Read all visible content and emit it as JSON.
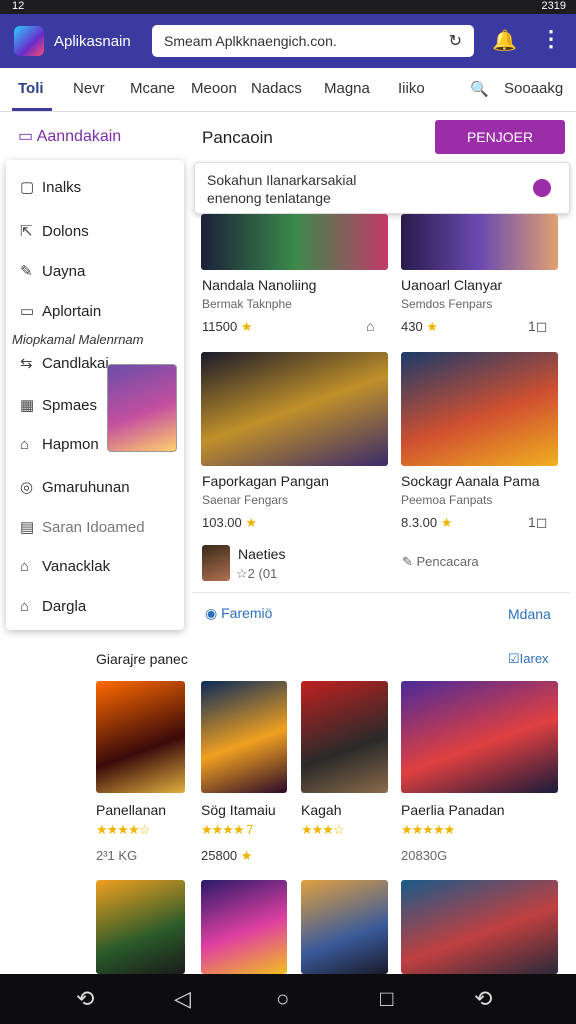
{
  "status": {
    "left": "12",
    "right": "2319"
  },
  "appbar": {
    "title": "Aplikasnain",
    "url": "Smeam Aplkknaengich.con."
  },
  "tabs": [
    "Toli",
    "Nevr",
    "Mcane",
    "Meoon",
    "Nadacs",
    "Magna",
    "Iiiko",
    "Sooaakg"
  ],
  "menu": {
    "header": "Aanndakain",
    "items": [
      "Inalks",
      "Dolons",
      "Uayna",
      "Aplortain",
      "Candlakai",
      "Spmaes",
      "Hapmon",
      "Gmaruhunan",
      "Saran Idoamed",
      "Vanacklak",
      "Dargla"
    ],
    "overlay_text": "Miopkamal Malenrnam"
  },
  "page": {
    "title": "Pancaoin",
    "primary_button": "PENJOER",
    "tooltip": "Sokahun Ilanarkarsakial\nenenong tenlatange"
  },
  "games": [
    {
      "title": "Nandala Nanoliing",
      "sub": "Bermak Taknphe",
      "price": "11500",
      "extra": "⌂"
    },
    {
      "title": "Uanoarl Clanyar",
      "sub": "Semdos Fenpars",
      "price": "430",
      "extra": "1◻"
    },
    {
      "title": "Faporkagan Pangan",
      "sub": "Saenar Fengars",
      "price": "103.00",
      "extra": ""
    },
    {
      "title": "Sockagr Aanala Pama",
      "sub": "Peemoa Fanpats",
      "price": "8.3.00",
      "extra": "1◻"
    }
  ],
  "mini": {
    "title": "Naeties",
    "rating": "☆2 (01",
    "right_label": "Pencacara"
  },
  "links": {
    "left": "Faremiö",
    "right": "Mdana"
  },
  "section2": {
    "title": "Giarajre panec",
    "link": "Iarex",
    "items": [
      {
        "title": "Panellanan",
        "meta": "2³1 KG",
        "rating": "★★★★☆"
      },
      {
        "title": "Sög Itamaiu",
        "meta": "25800",
        "rating": "★★★★ 7"
      },
      {
        "title": "Kagah",
        "meta": "",
        "rating": "★★★☆"
      },
      {
        "title": "Paerlia Panadan",
        "meta": "20830G",
        "rating": "★★★★★"
      }
    ]
  },
  "colors": {
    "appbar": "#3a3aa0",
    "accent": "#9b2ea8",
    "link": "#2c6fbf"
  }
}
